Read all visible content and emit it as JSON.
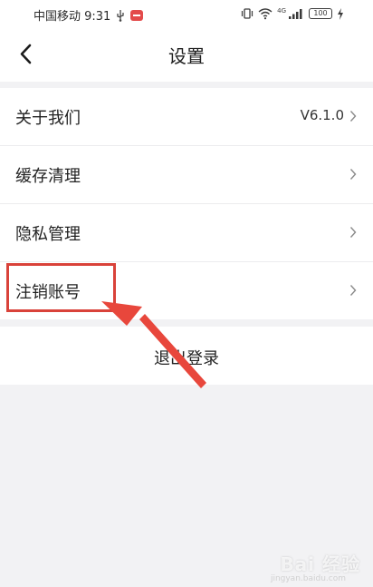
{
  "status_bar": {
    "carrier_time": "中国移动 9:31",
    "network_label": "4G",
    "battery_label": "100"
  },
  "nav": {
    "title": "设置"
  },
  "settings": {
    "items": [
      {
        "label": "关于我们",
        "value": "V6.1.0"
      },
      {
        "label": "缓存清理",
        "value": ""
      },
      {
        "label": "隐私管理",
        "value": ""
      },
      {
        "label": "注销账号",
        "value": ""
      }
    ]
  },
  "logout": {
    "label": "退出登录"
  },
  "annotation": {
    "highlight_color": "#d9423a",
    "arrow_color": "#e8473c"
  },
  "watermark": {
    "text": "Bai 经验",
    "sub": "jingyan.baidu.com"
  }
}
